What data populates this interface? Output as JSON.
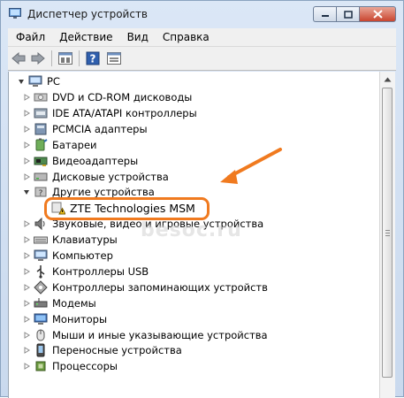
{
  "window": {
    "title": "Диспетчер устройств"
  },
  "menubar": {
    "items": [
      "Файл",
      "Действие",
      "Вид",
      "Справка"
    ]
  },
  "toolbar": {
    "buttons": [
      "back-icon",
      "forward-icon",
      "properties-icon",
      "help-icon",
      "view-icon"
    ]
  },
  "tree": {
    "root": "PC",
    "categories": [
      {
        "label": "DVD и CD-ROM дисководы",
        "icon": "dvd-icon"
      },
      {
        "label": "IDE ATA/ATAPI контроллеры",
        "icon": "ide-icon"
      },
      {
        "label": "PCMCIA адаптеры",
        "icon": "pcmcia-icon"
      },
      {
        "label": "Батареи",
        "icon": "battery-icon"
      },
      {
        "label": "Видеоадаптеры",
        "icon": "display-adapter-icon"
      },
      {
        "label": "Дисковые устройства",
        "icon": "disk-icon"
      },
      {
        "label": "Другие устройства",
        "icon": "other-devices-icon",
        "expanded": true
      },
      {
        "label": "ZTE Technologies MSM",
        "icon": "warning-device-icon",
        "child": true
      },
      {
        "label": "Звуковые, видео и игровые устройства",
        "icon": "sound-icon"
      },
      {
        "label": "Клавиатуры",
        "icon": "keyboard-icon"
      },
      {
        "label": "Компьютер",
        "icon": "computer-icon"
      },
      {
        "label": "Контроллеры USB",
        "icon": "usb-icon"
      },
      {
        "label": "Контроллеры запоминающих устройств",
        "icon": "storage-controller-icon"
      },
      {
        "label": "Модемы",
        "icon": "modem-icon"
      },
      {
        "label": "Мониторы",
        "icon": "monitor-icon"
      },
      {
        "label": "Мыши и иные указывающие устройства",
        "icon": "mouse-icon"
      },
      {
        "label": "Переносные устройства",
        "icon": "portable-device-icon"
      },
      {
        "label": "Процессоры",
        "icon": "processor-icon"
      }
    ]
  },
  "annotation": {
    "highlight_color": "#f07a1f"
  },
  "watermark": "besoc.ru"
}
